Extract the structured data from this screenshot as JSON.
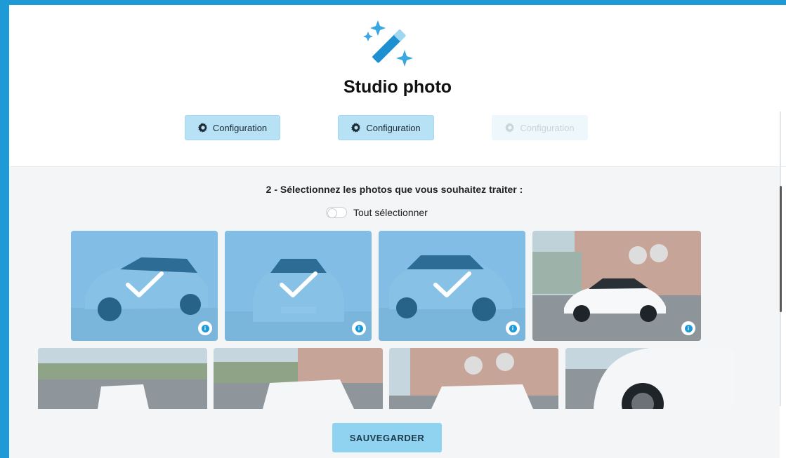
{
  "modal": {
    "title": "Studio photo",
    "close_label": "×",
    "logo_icon": "magic-wand-icon"
  },
  "config_buttons": [
    {
      "label": "Configuration",
      "enabled": true
    },
    {
      "label": "Configuration",
      "enabled": true
    },
    {
      "label": "Configuration",
      "enabled": false
    }
  ],
  "selection": {
    "instruction": "2 - Sélectionnez les photos que vous souhaitez traiter :",
    "select_all_label": "Tout sélectionner",
    "select_all_checked": false
  },
  "photos": [
    {
      "subject": "car-front-three-quarter-studio",
      "selected": true,
      "info_icon": "info-icon"
    },
    {
      "subject": "car-front-studio",
      "selected": true,
      "info_icon": "info-icon"
    },
    {
      "subject": "car-front-three-quarter-left-studio",
      "selected": true,
      "info_icon": "info-icon"
    },
    {
      "subject": "car-side-parking",
      "selected": false,
      "info_icon": "info-icon"
    },
    {
      "subject": "car-rear-parking",
      "selected": false
    },
    {
      "subject": "car-rear-three-quarter-parking",
      "selected": false
    },
    {
      "subject": "car-side-building",
      "selected": false
    },
    {
      "subject": "car-wheel-closeup",
      "selected": false
    }
  ],
  "actions": {
    "save_label": "SAUVEGARDER"
  },
  "colors": {
    "accent": "#1e9ad6",
    "button_bg": "#b7e1f5",
    "save_bg": "#8fd3f1",
    "selected_tint": "#2d96d7"
  }
}
